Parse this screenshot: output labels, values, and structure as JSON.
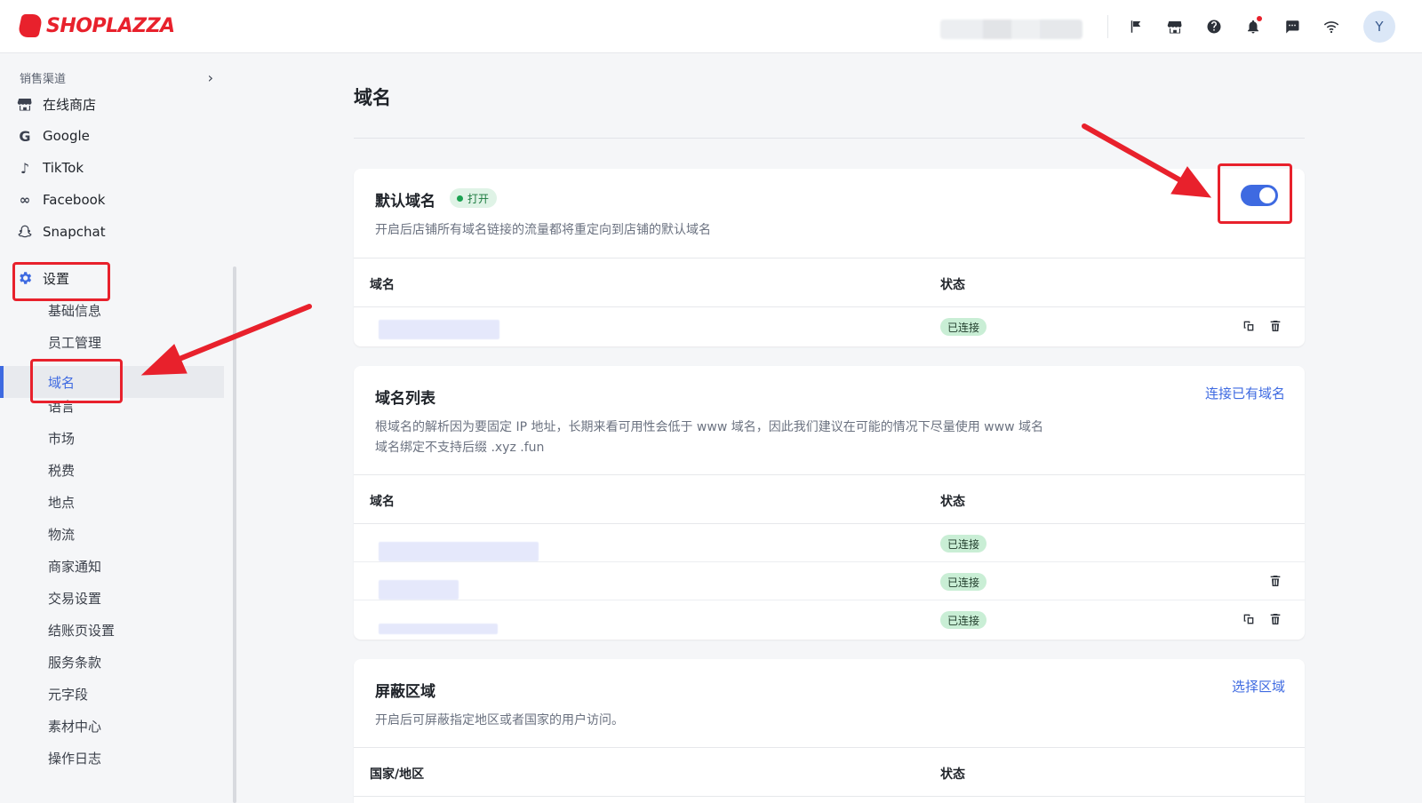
{
  "header": {
    "brand": "SHOPLAZZA",
    "avatar_initial": "Y",
    "icons": [
      "flag-icon",
      "store-icon",
      "help-icon",
      "bell-icon",
      "message-icon",
      "wifi-icon"
    ]
  },
  "sidebar": {
    "section_label": "销售渠道",
    "channels": [
      {
        "label": "在线商店",
        "icon": "store-icon"
      },
      {
        "label": "Google",
        "icon": "google-icon"
      },
      {
        "label": "TikTok",
        "icon": "tiktok-icon"
      },
      {
        "label": "Facebook",
        "icon": "meta-icon"
      },
      {
        "label": "Snapchat",
        "icon": "snapchat-icon"
      }
    ],
    "settings_label": "设置",
    "settings_items": [
      "基础信息",
      "员工管理",
      "域名",
      "语言",
      "市场",
      "税费",
      "地点",
      "物流",
      "商家通知",
      "交易设置",
      "结账页设置",
      "服务条款",
      "元字段",
      "素材中心",
      "操作日志"
    ],
    "active_item": "域名"
  },
  "main": {
    "page_title": "域名",
    "default_domain": {
      "title": "默认域名",
      "badge": "打开",
      "description": "开启后店铺所有域名链接的流量都将重定向到店铺的默认域名",
      "toggle_on": true,
      "col_domain": "域名",
      "col_status": "状态",
      "rows": [
        {
          "status": "已连接"
        }
      ]
    },
    "domain_list": {
      "title": "域名列表",
      "link": "连接已有域名",
      "description_1": "根域名的解析因为要固定 IP 地址，长期来看可用性会低于 www 域名，因此我们建议在可能的情况下尽量使用 www 域名",
      "description_2": "域名绑定不支持后缀 .xyz .fun",
      "col_domain": "域名",
      "col_status": "状态",
      "rows": [
        {
          "status": "已连接"
        },
        {
          "status": "已连接"
        },
        {
          "status": "已连接"
        }
      ]
    },
    "blocked_regions": {
      "title": "屏蔽区域",
      "link": "选择区域",
      "description": "开启后可屏蔽指定地区或者国家的用户访问。",
      "col_region": "国家/地区",
      "col_status": "状态"
    }
  },
  "colors": {
    "accent": "#3e6ae1",
    "brand": "#e8212c",
    "success_bg": "#c9eed5"
  }
}
